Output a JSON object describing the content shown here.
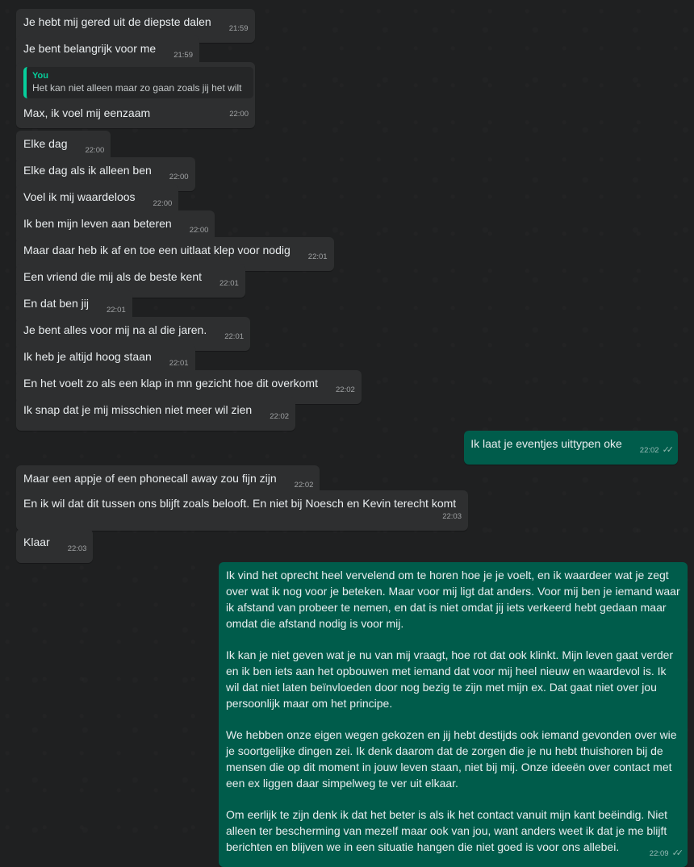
{
  "messages": [
    {
      "text": "Je hebt mij gered uit de diepste dalen",
      "time": "21:59"
    },
    {
      "text": "Je bent belangrijk voor me",
      "time": "21:59"
    },
    {
      "quote_author": "You",
      "quote_text": "Het kan niet alleen maar zo gaan zoals jij het wilt",
      "text": "Max, ik voel mij eenzaam",
      "time": "22:00"
    },
    {
      "text": "Elke dag",
      "time": "22:00"
    },
    {
      "text": "Elke dag als ik alleen ben",
      "time": "22:00"
    },
    {
      "text": "Voel ik mij waardeloos",
      "time": "22:00"
    },
    {
      "text": "Ik ben mijn leven aan beteren",
      "time": "22:00"
    },
    {
      "text": "Maar daar heb ik af en toe een uitlaat klep voor nodig",
      "time": "22:01"
    },
    {
      "text": "Een vriend die mij als de beste kent",
      "time": "22:01"
    },
    {
      "text": "En dat ben jij",
      "time": "22:01"
    },
    {
      "text": "Je bent alles voor mij na al die jaren.",
      "time": "22:01"
    },
    {
      "text": "Ik heb je altijd hoog staan",
      "time": "22:01"
    },
    {
      "text": "En het voelt zo als een klap in mn gezicht hoe dit overkomt",
      "time": "22:02"
    },
    {
      "text": "Ik snap dat je mij misschien niet meer wil zien",
      "time": "22:02"
    },
    {
      "text": "Ik laat je eventjes uittypen oke",
      "time": "22:02"
    },
    {
      "text": "Maar een appje of een phonecall away zou fijn zijn",
      "time": "22:02"
    },
    {
      "text": "En ik wil dat dit tussen ons blijft zoals belooft. En niet bij Noesch en Kevin terecht komt",
      "time": "22:03"
    },
    {
      "text": "Klaar",
      "time": "22:03"
    },
    {
      "paragraphs": [
        "Ik vind het oprecht heel vervelend om te horen hoe je je voelt, en ik waardeer wat je zegt over wat ik nog voor je beteken. Maar voor mij ligt dat anders. Voor mij ben je iemand waar ik afstand van probeer te nemen, en dat is niet omdat jij iets verkeerd hebt gedaan maar omdat die afstand nodig is voor mij.",
        "Ik kan je niet geven wat je nu van mij vraagt, hoe rot dat ook klinkt. Mijn leven gaat verder en ik ben iets aan het opbouwen met iemand dat voor mij heel nieuw en waardevol is. Ik wil dat niet laten beïnvloeden door nog bezig te zijn met mijn ex. Dat gaat niet over jou persoonlijk maar om het principe.",
        "We hebben onze eigen wegen gekozen en jij hebt destijds ook iemand gevonden over wie je soortgelijke dingen zei. Ik denk daarom dat de zorgen die je nu hebt thuishoren bij de mensen die op dit moment in jouw leven staan, niet bij mij. Onze ideeën over contact met een ex liggen daar simpelweg te ver uit elkaar.",
        "Om eerlijk te zijn denk ik dat het beter is als ik het contact vanuit mijn kant beëindig. Niet alleen ter bescherming van mezelf maar ook van jou, want anders weet ik dat je me blijft berichten en blijven we in een situatie hangen die niet goed is voor ons allebei."
      ],
      "time": "22:09"
    }
  ],
  "colors": {
    "background": "#1f2021",
    "incoming_bubble": "#2e2f30",
    "outgoing_bubble": "#005c4b",
    "quote_accent": "#06cf9c",
    "read_ticks": "#8fb8ad"
  },
  "icons": {
    "read_receipt": "double-check-icon"
  }
}
